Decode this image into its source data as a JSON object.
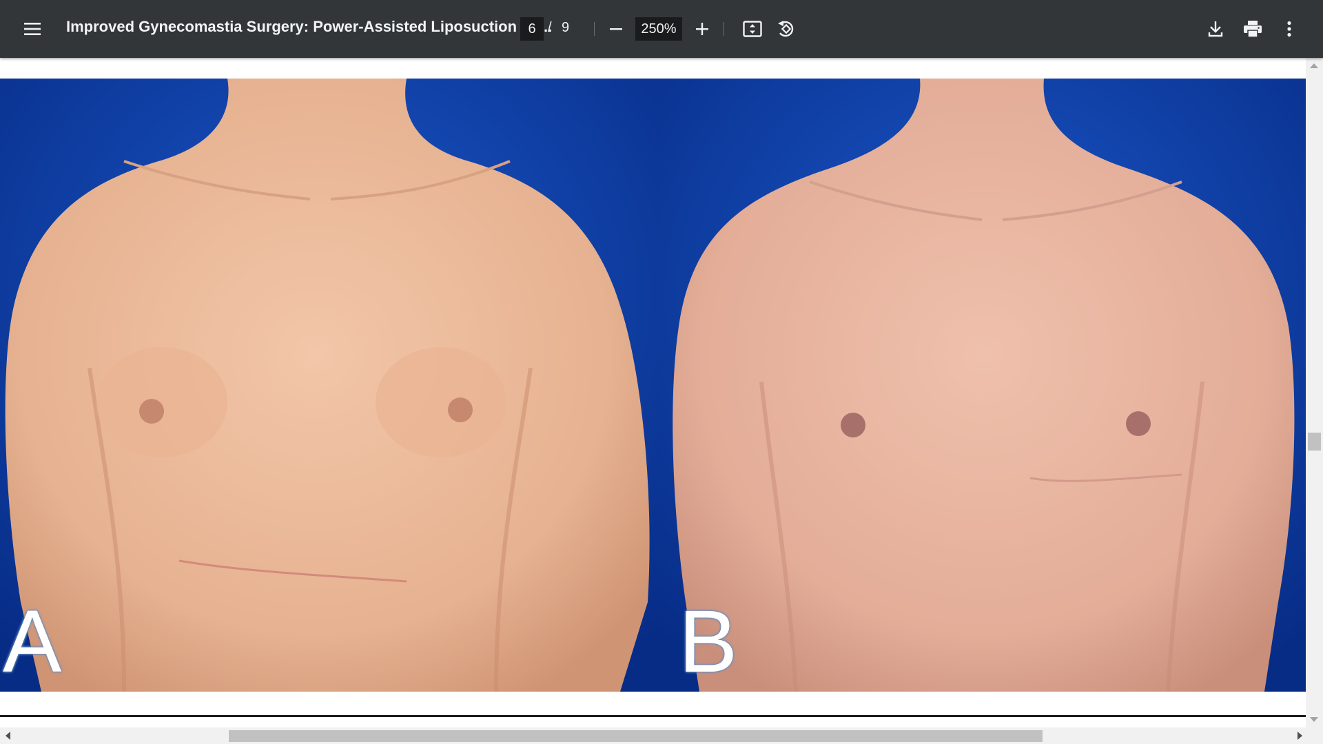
{
  "toolbar": {
    "menu_icon": "hamburger-menu-icon",
    "title": "Improved Gynecomastia Surgery: Power-Assisted Liposuction Wi...",
    "current_page": "6",
    "page_separator": "/",
    "total_pages": "9",
    "zoom_out_icon": "minus-icon",
    "zoom_level": "250%",
    "zoom_in_icon": "plus-icon",
    "fit_page_icon": "fit-to-page-icon",
    "rotate_icon": "rotate-counterclockwise-icon",
    "download_icon": "download-icon",
    "print_icon": "print-icon",
    "more_icon": "more-vertical-icon"
  },
  "figure": {
    "panel_a_label": "A",
    "panel_b_label": "B"
  },
  "colors": {
    "toolbar_bg": "#323639",
    "toolbar_text": "#f1f3f4",
    "input_bg": "#191b1c",
    "backdrop_blue": "#0a3a9c",
    "skin_tone": "#e9b89a"
  }
}
